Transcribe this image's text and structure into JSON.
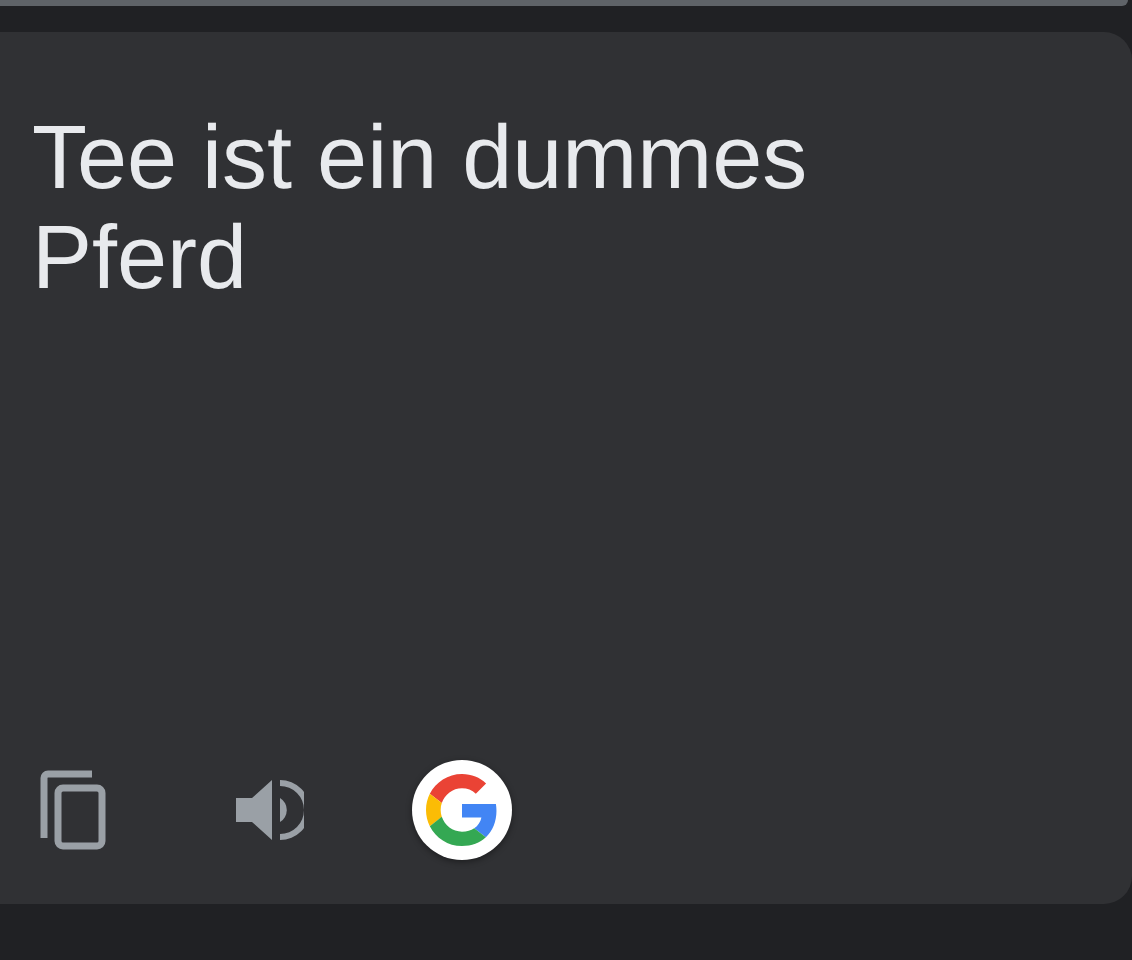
{
  "translation": {
    "text": "Tee ist ein dummes Pferd"
  }
}
